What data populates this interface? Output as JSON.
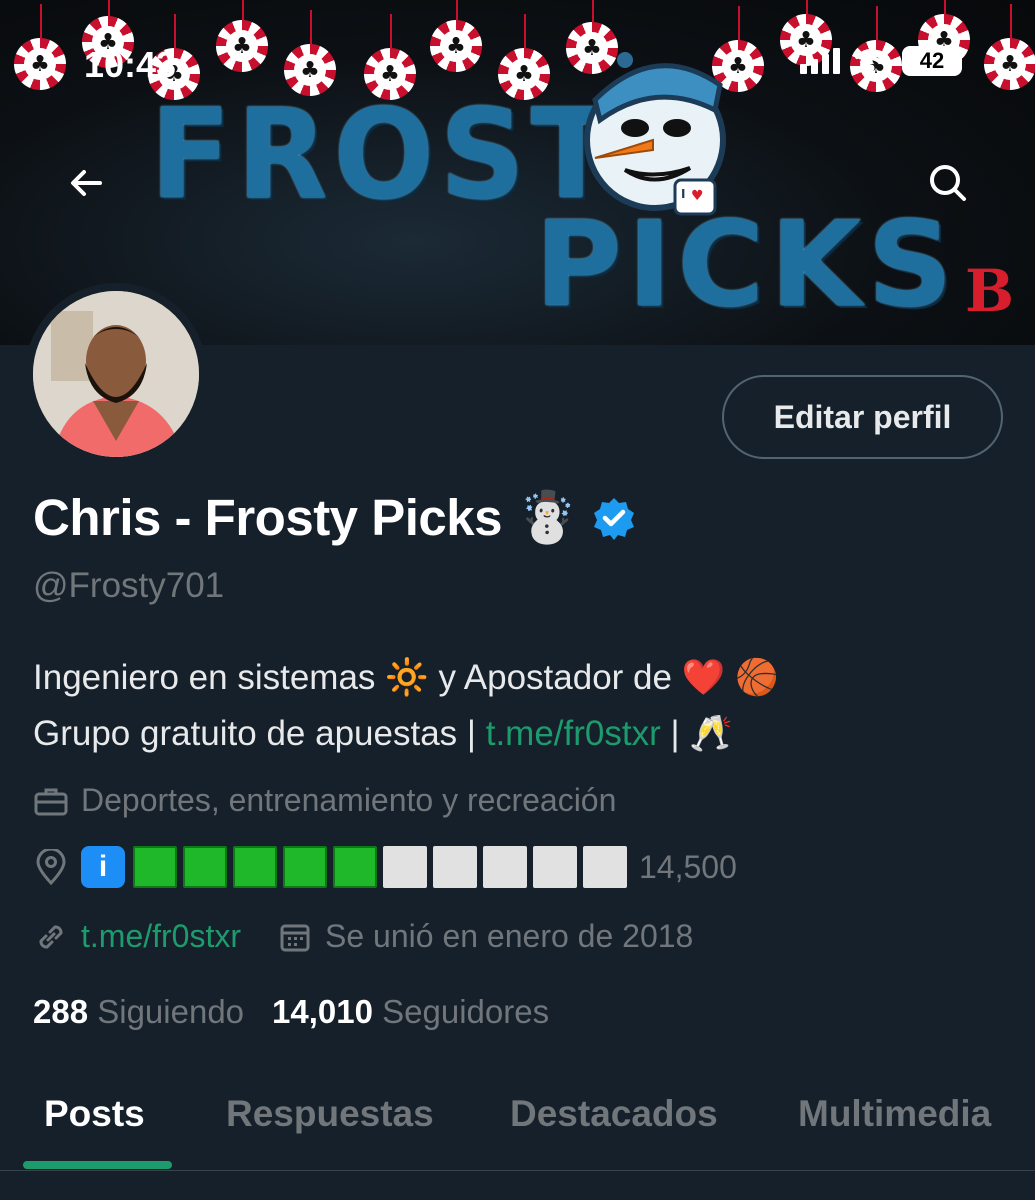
{
  "status_bar": {
    "time": "10:43",
    "battery": "42"
  },
  "banner": {
    "logo_line1": "FROSTY",
    "logo_line2": "PICKS",
    "brand": "BD"
  },
  "header": {
    "back_icon": "arrow-left-icon",
    "search_icon": "search-icon"
  },
  "profile": {
    "edit_label": "Editar perfil",
    "name": "Chris - Frosty Picks",
    "name_emoji": "☃️",
    "handle": "@Frosty701",
    "bio_line1_a": "Ingeniero en sistemas",
    "bio_line1_emoji1": "🔆",
    "bio_line1_b": "y Apostador de",
    "bio_line1_emoji2": "❤️",
    "bio_line1_emoji3": "🏀",
    "bio_line2_a": "Grupo gratuito de apuestas |",
    "bio_line2_link": "t.me/fr0stxr",
    "bio_line2_b": "|",
    "bio_line2_emoji": "🥂",
    "category": "Deportes, entrenamiento y recreación",
    "location_progress": {
      "filled": 5,
      "total": 10,
      "label": "14,500"
    },
    "website": "t.me/fr0stxr",
    "joined": "Se unió en enero de 2018",
    "following_count": "288",
    "following_label": "Siguiendo",
    "followers_count": "14,010",
    "followers_label": "Seguidores"
  },
  "tabs": {
    "posts": "Posts",
    "replies": "Respuestas",
    "highlights": "Destacados",
    "media": "Multimedia"
  },
  "colors": {
    "background": "#15202b",
    "accent": "#1d9b6c",
    "verified": "#1d9bf0"
  }
}
